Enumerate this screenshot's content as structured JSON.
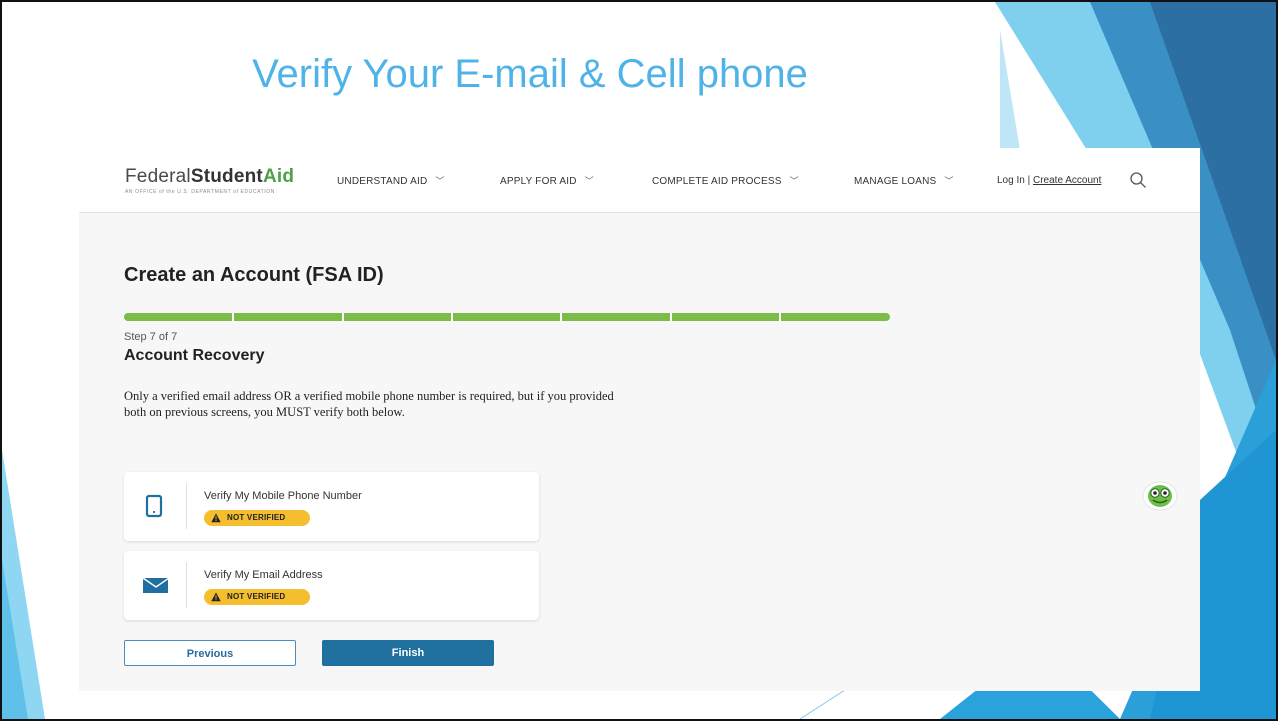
{
  "slide": {
    "title": "Verify Your E-mail & Cell phone"
  },
  "nav": {
    "logo_main": "Federal",
    "logo_student": "Student",
    "logo_aid": "Aid",
    "logo_tagline": "AN OFFICE of the U.S. DEPARTMENT of EDUCATION",
    "menu": [
      {
        "label": "UNDERSTAND AID"
      },
      {
        "label": "APPLY FOR AID"
      },
      {
        "label": "COMPLETE AID PROCESS"
      },
      {
        "label": "MANAGE LOANS"
      }
    ],
    "login": "Log In",
    "separator": "|",
    "create_account": "Create Account"
  },
  "page": {
    "heading": "Create an Account (FSA ID)",
    "progress": {
      "current_step": 7,
      "total_steps": 7
    },
    "step_text": "Step 7 of 7",
    "section_title": "Account Recovery",
    "description": "Only a verified email address OR a verified mobile phone number is required, but if you provided both on previous screens, you MUST verify both below."
  },
  "verify_cards": [
    {
      "label": "Verify My Mobile Phone Number",
      "status": "NOT VERIFIED",
      "icon": "mobile-phone-icon"
    },
    {
      "label": "Verify My Email Address",
      "status": "NOT VERIFIED",
      "icon": "envelope-icon"
    }
  ],
  "buttons": {
    "previous": "Previous",
    "finish": "Finish"
  },
  "colors": {
    "slide_title": "#4fb3e8",
    "progress": "#7cbd48",
    "badge": "#f5be2e",
    "finish_button": "#1f6f9f",
    "icon_blue": "#1f6f9f"
  }
}
